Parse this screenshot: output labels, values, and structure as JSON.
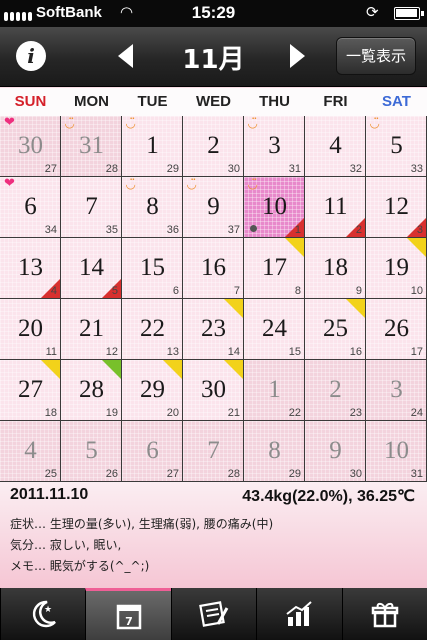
{
  "status": {
    "carrier": "SoftBank",
    "time": "15:29"
  },
  "nav": {
    "month": "11月",
    "list_label": "一覧表示",
    "info": "i"
  },
  "weekdays": [
    "SUN",
    "MON",
    "TUE",
    "WED",
    "THU",
    "FRI",
    "SAT"
  ],
  "weeks": [
    [
      {
        "d": "30",
        "c": "27",
        "other": true,
        "heart": true
      },
      {
        "d": "31",
        "c": "28",
        "other": true,
        "smile": true
      },
      {
        "d": "1",
        "c": "29",
        "smile": true
      },
      {
        "d": "2",
        "c": "30"
      },
      {
        "d": "3",
        "c": "31",
        "smile": true
      },
      {
        "d": "4",
        "c": "32"
      },
      {
        "d": "5",
        "c": "33",
        "smile": true
      }
    ],
    [
      {
        "d": "6",
        "c": "34",
        "heart": true
      },
      {
        "d": "7",
        "c": "35"
      },
      {
        "d": "8",
        "c": "36",
        "smile": true
      },
      {
        "d": "9",
        "c": "37",
        "smile": true
      },
      {
        "d": "10",
        "c": "1",
        "smile": true,
        "selected": true,
        "red": true,
        "dot": true
      },
      {
        "d": "11",
        "c": "2",
        "red": true
      },
      {
        "d": "12",
        "c": "3",
        "red": true
      }
    ],
    [
      {
        "d": "13",
        "c": "4",
        "red": true
      },
      {
        "d": "14",
        "c": "5",
        "red": true
      },
      {
        "d": "15",
        "c": "6"
      },
      {
        "d": "16",
        "c": "7"
      },
      {
        "d": "17",
        "c": "8",
        "yellow": true
      },
      {
        "d": "18",
        "c": "9"
      },
      {
        "d": "19",
        "c": "10",
        "yellow": true
      }
    ],
    [
      {
        "d": "20",
        "c": "11"
      },
      {
        "d": "21",
        "c": "12"
      },
      {
        "d": "22",
        "c": "13"
      },
      {
        "d": "23",
        "c": "14",
        "yellow": true
      },
      {
        "d": "24",
        "c": "15"
      },
      {
        "d": "25",
        "c": "16",
        "yellow": true
      },
      {
        "d": "26",
        "c": "17"
      }
    ],
    [
      {
        "d": "27",
        "c": "18",
        "yellow": true
      },
      {
        "d": "28",
        "c": "19",
        "green": true
      },
      {
        "d": "29",
        "c": "20",
        "yellow": true
      },
      {
        "d": "30",
        "c": "21",
        "yellow": true
      },
      {
        "d": "1",
        "c": "22",
        "other": true
      },
      {
        "d": "2",
        "c": "23",
        "other": true
      },
      {
        "d": "3",
        "c": "24",
        "other": true
      }
    ],
    [
      {
        "d": "4",
        "c": "25",
        "other": true
      },
      {
        "d": "5",
        "c": "26",
        "other": true
      },
      {
        "d": "6",
        "c": "27",
        "other": true
      },
      {
        "d": "7",
        "c": "28",
        "other": true
      },
      {
        "d": "8",
        "c": "29",
        "other": true
      },
      {
        "d": "9",
        "c": "30",
        "other": true
      },
      {
        "d": "10",
        "c": "31",
        "other": true
      }
    ]
  ],
  "detail": {
    "date": "2011.11.10",
    "weight": "43.4kg(22.0%), 36.25℃",
    "symptoms": "症状… 生理の量(多い), 生理痛(弱), 腰の痛み(中)",
    "mood": "気分… 寂しい, 眠い,",
    "memo": "メモ… 眠気がする(^_^;)"
  },
  "tabs": [
    "moon-icon",
    "calendar-icon",
    "notes-icon",
    "chart-icon",
    "gift-icon"
  ],
  "colors": {
    "selected": "#e889cb",
    "period_marker": "#d8302f",
    "yellow_marker": "#f2d21a",
    "green_marker": "#78c02a",
    "heart": "#ee2f7e",
    "smile": "#ee9233",
    "sunday": "#d5202a",
    "saturday": "#3d6ad6",
    "active_tab": "#ef5f96"
  }
}
